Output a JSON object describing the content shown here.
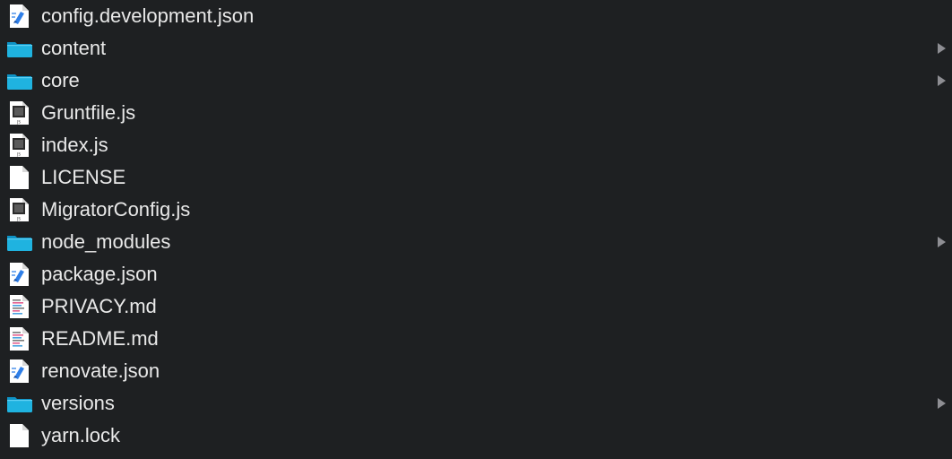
{
  "file_list": {
    "items": [
      {
        "name": "config.development.json",
        "kind": "json",
        "icon": "json-file-icon"
      },
      {
        "name": "content",
        "kind": "folder",
        "icon": "folder-icon"
      },
      {
        "name": "core",
        "kind": "folder",
        "icon": "folder-icon"
      },
      {
        "name": "Gruntfile.js",
        "kind": "js",
        "icon": "js-file-icon"
      },
      {
        "name": "index.js",
        "kind": "js",
        "icon": "js-file-icon"
      },
      {
        "name": "LICENSE",
        "kind": "plain",
        "icon": "document-icon"
      },
      {
        "name": "MigratorConfig.js",
        "kind": "js",
        "icon": "js-file-icon"
      },
      {
        "name": "node_modules",
        "kind": "folder",
        "icon": "folder-icon"
      },
      {
        "name": "package.json",
        "kind": "json",
        "icon": "json-file-icon"
      },
      {
        "name": "PRIVACY.md",
        "kind": "md",
        "icon": "markdown-file-icon"
      },
      {
        "name": "README.md",
        "kind": "md",
        "icon": "markdown-file-icon"
      },
      {
        "name": "renovate.json",
        "kind": "json",
        "icon": "json-file-icon"
      },
      {
        "name": "versions",
        "kind": "folder",
        "icon": "folder-icon"
      },
      {
        "name": "yarn.lock",
        "kind": "plain",
        "icon": "document-icon"
      }
    ]
  },
  "colors": {
    "background": "#1e2022",
    "text": "#e9e9e9",
    "folder": "#1fb3e0",
    "folder_tab": "#0d8fbf",
    "disclosure": "#8e8e93",
    "json_accent": "#2f7fe8"
  }
}
